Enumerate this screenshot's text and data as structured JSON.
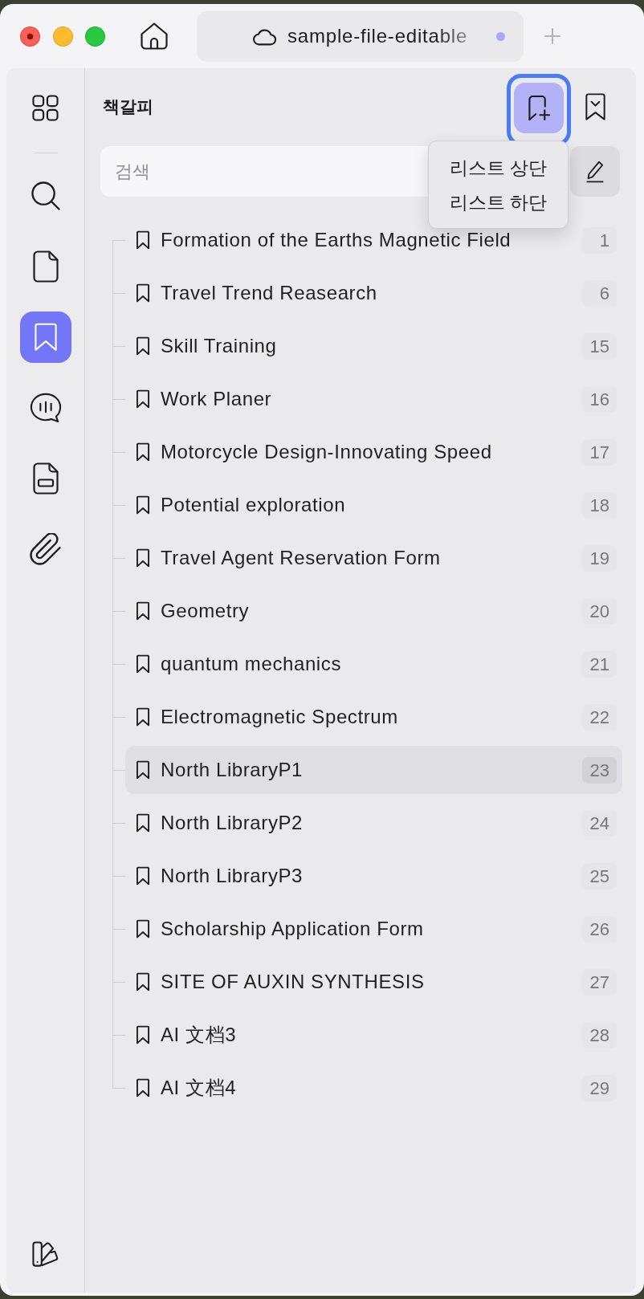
{
  "tab_bar": {
    "tab": {
      "title": "sample-file-editable",
      "unsaved": true
    }
  },
  "sidebar": {
    "items": [
      {
        "kind": "thumbnails",
        "selected": false
      },
      {
        "kind": "search",
        "selected": false
      },
      {
        "kind": "pages",
        "selected": false
      },
      {
        "kind": "bookmarks",
        "selected": true
      },
      {
        "kind": "comments",
        "selected": false
      },
      {
        "kind": "forms",
        "selected": false
      },
      {
        "kind": "attachments",
        "selected": false
      }
    ]
  },
  "panel": {
    "title": "책갈피",
    "add_button": {
      "focused": true
    },
    "search": {
      "placeholder": "검색"
    },
    "add_menu": {
      "open": true,
      "items": [
        "리스트 상단",
        "리스트 하단"
      ]
    },
    "bookmarks": [
      {
        "title": "Formation of the Earths Magnetic Field",
        "page": "1",
        "selected": false
      },
      {
        "title": "Travel Trend Reasearch",
        "page": "6",
        "selected": false
      },
      {
        "title": "Skill Training",
        "page": "15",
        "selected": false
      },
      {
        "title": "Work Planer",
        "page": "16",
        "selected": false
      },
      {
        "title": "Motorcycle Design-Innovating Speed",
        "page": "17",
        "selected": false
      },
      {
        "title": "Potential exploration",
        "page": "18",
        "selected": false
      },
      {
        "title": "Travel Agent Reservation Form",
        "page": "19",
        "selected": false
      },
      {
        "title": "Geometry",
        "page": "20",
        "selected": false
      },
      {
        "title": "quantum mechanics",
        "page": "21",
        "selected": false
      },
      {
        "title": "Electromagnetic Spectrum",
        "page": "22",
        "selected": false
      },
      {
        "title": "North LibraryP1",
        "page": "23",
        "selected": true
      },
      {
        "title": "North LibraryP2",
        "page": "24",
        "selected": false
      },
      {
        "title": "North LibraryP3",
        "page": "25",
        "selected": false
      },
      {
        "title": "Scholarship Application Form",
        "page": "26",
        "selected": false
      },
      {
        "title": "SITE OF AUXIN SYNTHESIS",
        "page": "27",
        "selected": false
      },
      {
        "title": "AI 文档3",
        "page": "28",
        "selected": false
      },
      {
        "title": "AI 文档4",
        "page": "29",
        "selected": false
      }
    ]
  }
}
